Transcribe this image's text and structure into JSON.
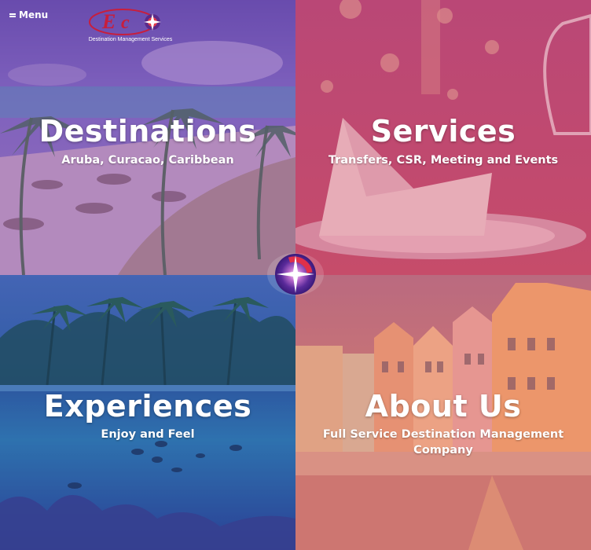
{
  "header": {
    "menu_label": "Menu",
    "logo_text": "EcO",
    "logo_tagline": "Destination Management Services"
  },
  "tiles": [
    {
      "title": "Destinations",
      "subtitle": "Aruba, Curacao, Caribbean"
    },
    {
      "title": "Services",
      "subtitle": "Transfers, CSR, Meeting and Events"
    },
    {
      "title": "Experiences",
      "subtitle": "Enjoy and Feel"
    },
    {
      "title": "About Us",
      "subtitle": "Full Service Destination Management Company"
    }
  ],
  "colors": {
    "overlay_purple": "#8a4aa8",
    "overlay_red": "#c03f6a",
    "overlay_blue": "#2f5aa8",
    "overlay_orange": "#e0745a",
    "brand_red": "#c81e3c",
    "brand_purple": "#5a2a8a"
  }
}
